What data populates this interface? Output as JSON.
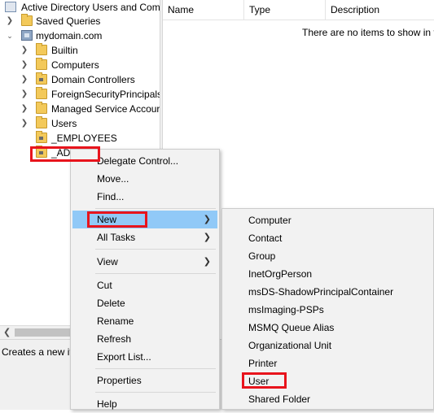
{
  "tree": {
    "items": [
      {
        "label": "Active Directory Users and Com",
        "icon": "ad-console-icon"
      },
      {
        "label": "Saved Queries",
        "icon": "folder-icon"
      },
      {
        "label": "mydomain.com",
        "icon": "domain-icon"
      },
      {
        "label": "Builtin",
        "icon": "folder-icon"
      },
      {
        "label": "Computers",
        "icon": "folder-icon"
      },
      {
        "label": "Domain Controllers",
        "icon": "ou-folder-icon"
      },
      {
        "label": "ForeignSecurityPrincipals",
        "icon": "folder-icon"
      },
      {
        "label": "Managed Service Accour",
        "icon": "folder-icon"
      },
      {
        "label": "Users",
        "icon": "folder-icon"
      },
      {
        "label": "_EMPLOYEES",
        "icon": "ou-folder-icon"
      },
      {
        "label": "_ADI",
        "icon": "ou-folder-icon"
      }
    ]
  },
  "list": {
    "columns": [
      "Name",
      "Type",
      "Description"
    ],
    "empty_message": "There are no items to show in t"
  },
  "status": {
    "text": "Creates a new ite"
  },
  "context_menu": {
    "items": [
      "Delegate Control...",
      "Move...",
      "Find...",
      "New",
      "All Tasks",
      "View",
      "Cut",
      "Delete",
      "Rename",
      "Refresh",
      "Export List...",
      "Properties",
      "Help"
    ]
  },
  "submenu": {
    "items": [
      "Computer",
      "Contact",
      "Group",
      "InetOrgPerson",
      "msDS-ShadowPrincipalContainer",
      "msImaging-PSPs",
      "MSMQ Queue Alias",
      "Organizational Unit",
      "Printer",
      "User",
      "Shared Folder"
    ]
  },
  "colors": {
    "highlight": "#91c9f7",
    "annotation_red": "#e8141c"
  }
}
